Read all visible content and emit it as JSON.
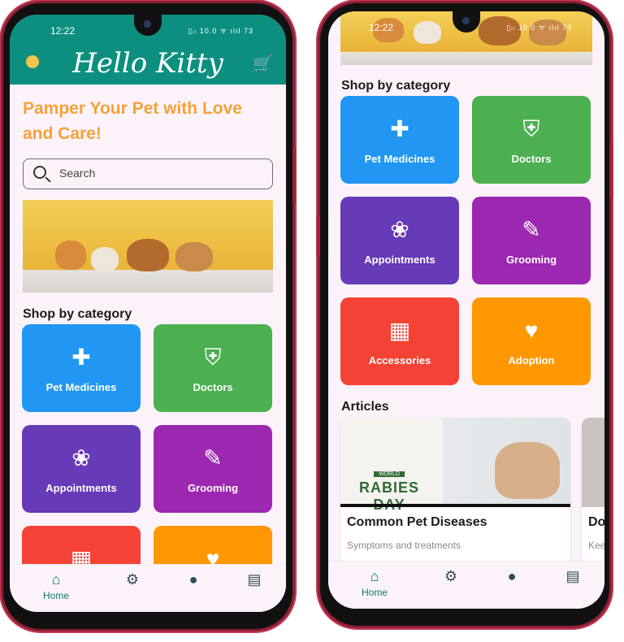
{
  "status": {
    "time": "12:22",
    "battery": "73",
    "signal_icons": "▯ᵢₗ 10.0 ᯤ ılıl"
  },
  "app": {
    "title": "Hello Kitty"
  },
  "home": {
    "headline": "Pamper Your Pet with Love and Care!",
    "search_placeholder": "Search",
    "shop_title": "Shop by category",
    "articles_title": "Articles"
  },
  "categories": [
    {
      "label": "Pet Medicines",
      "icon": "medical-kit-icon",
      "color": "#2196f3"
    },
    {
      "label": "Doctors",
      "icon": "shield-plus-icon",
      "color": "#4caf50"
    },
    {
      "label": "Appointments",
      "icon": "paw-icon",
      "color": "#673ab7"
    },
    {
      "label": "Grooming",
      "icon": "brush-icon",
      "color": "#9c27b0"
    },
    {
      "label": "Accessories",
      "icon": "store-icon",
      "color": "#f44336"
    },
    {
      "label": "Adoption",
      "icon": "heart-icon",
      "color": "#ff9800"
    }
  ],
  "articles": [
    {
      "title": "Common Pet Diseases",
      "subtitle": "Symptoms and treatments",
      "badge_top": "WORLD",
      "badge_main": "RABIES DAY"
    },
    {
      "title": "Do",
      "subtitle": "Kee"
    }
  ],
  "nav": {
    "home": "Home"
  }
}
